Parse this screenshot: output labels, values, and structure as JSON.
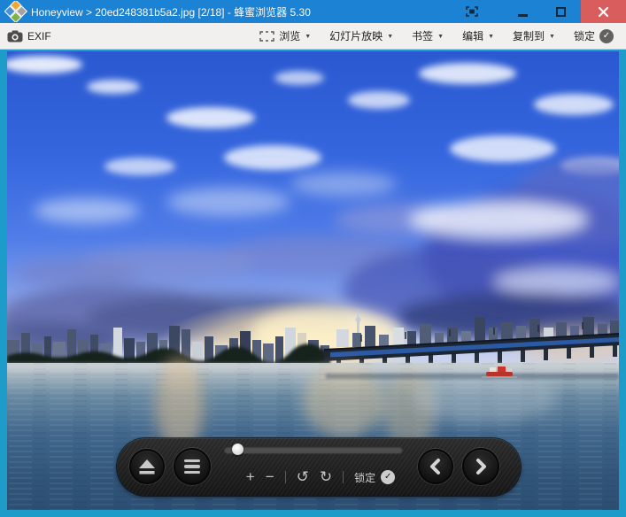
{
  "window": {
    "title": "Honeyview > 20ed248381b5a2.jpg [2/18] - 蜂蜜浏览器 5.30"
  },
  "toolbar": {
    "exif": "EXIF",
    "browse": "浏览",
    "slideshow": "幻灯片放映",
    "bookmarks": "书签",
    "edit": "编辑",
    "copy_to": "复制到",
    "lock": "锁定"
  },
  "controlbar": {
    "zoom_in": "+",
    "zoom_out": "−",
    "rotate_ccw": "↺",
    "rotate_cw": "↻",
    "lock": "锁定"
  },
  "icons": {
    "dropdown": "▼",
    "check": "✓"
  },
  "photo": {
    "description": "River cityscape at dusk: vivid blue cloudy sky, sunset glow behind a high-rise skyline with a tower, long bridge over water, small red boat"
  },
  "colors": {
    "titlebar": "#1b82d4",
    "close_button": "#d95d5c",
    "toolbar_bg": "#f1f0ee",
    "viewer_bg": "#1d9bc9",
    "controlbar_bg": "#1e1e1e"
  }
}
